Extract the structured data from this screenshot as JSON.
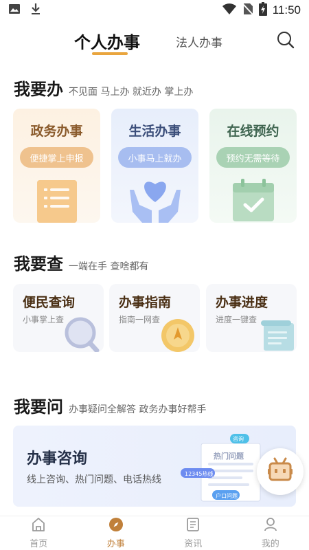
{
  "status_bar": {
    "time": "11:50"
  },
  "top_tabs": {
    "active": "个人办事",
    "inactive": "法人办事"
  },
  "section_do": {
    "title": "我要办",
    "subtitle": "不见面 马上办 就近办 掌上办",
    "cards": [
      {
        "title": "政务办事",
        "pill": "便捷掌上申报",
        "icon": "document-icon"
      },
      {
        "title": "生活办事",
        "pill": "小事马上就办",
        "icon": "heart-hands-icon"
      },
      {
        "title": "在线预约",
        "pill": "预约无需等待",
        "icon": "calendar-check-icon"
      }
    ]
  },
  "section_check": {
    "title": "我要查",
    "subtitle": "一端在手 查啥都有",
    "cards": [
      {
        "title": "便民查询",
        "subtitle": "小事掌上查",
        "icon": "magnifier-icon"
      },
      {
        "title": "办事指南",
        "subtitle": "指南一网查",
        "icon": "compass-coin-icon"
      },
      {
        "title": "办事进度",
        "subtitle": "进度一键查",
        "icon": "scroll-icon"
      }
    ]
  },
  "section_ask": {
    "title": "我要问",
    "subtitle": "办事疑问全解答 政务办事好帮手",
    "banner_title": "办事咨询",
    "banner_subtitle": "线上咨询、热门问题、电话热线",
    "illustration_texts": {
      "tag1": "咨询",
      "paper": "热门问题",
      "hotline": "12345热线",
      "tag2": "户口问题"
    }
  },
  "bottom_nav": [
    {
      "label": "首页",
      "icon": "home-icon",
      "active": false
    },
    {
      "label": "办事",
      "icon": "compass-icon",
      "active": true
    },
    {
      "label": "资讯",
      "icon": "news-icon",
      "active": false
    },
    {
      "label": "我的",
      "icon": "user-icon",
      "active": false
    }
  ],
  "colors": {
    "accent": "#e9a53e",
    "nav_active": "#c0803a"
  }
}
